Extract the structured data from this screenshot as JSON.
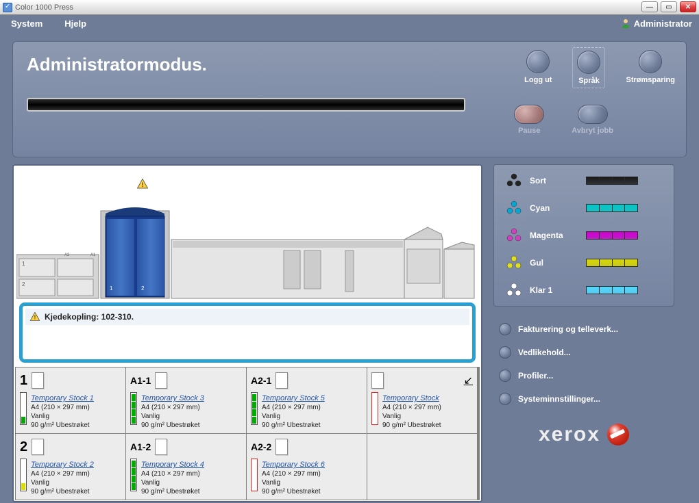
{
  "window": {
    "title": "Color 1000 Press"
  },
  "menu": {
    "system": "System",
    "help": "Hjelp",
    "admin": "Administrator"
  },
  "top": {
    "mode": "Administratormodus.",
    "logout": "Logg ut",
    "language": "Språk",
    "powersave": "Strømsparing",
    "pause": "Pause",
    "cancel": "Avbryt jobb"
  },
  "status": {
    "message": "Kjedekopling: 102-310."
  },
  "trays": {
    "size": "A4 (210 × 297 mm)",
    "type": "Vanlig",
    "coating": "90 g/m²   Ubestrøket",
    "items": [
      {
        "id": "1",
        "id_small": false,
        "stock": "Temporary Stock 1",
        "level_segs": [
          "green"
        ],
        "border": false
      },
      {
        "id": "A1-1",
        "id_small": true,
        "stock": "Temporary Stock 3",
        "level_segs": [
          "green",
          "green",
          "green",
          "green"
        ],
        "border": false
      },
      {
        "id": "A2-1",
        "id_small": true,
        "stock": "Temporary Stock 5",
        "level_segs": [
          "green",
          "green",
          "green",
          "green"
        ],
        "border": false
      },
      {
        "id": "",
        "id_small": true,
        "output": true,
        "stock": "Temporary Stock",
        "level_segs": [],
        "border": true
      },
      {
        "id": "2",
        "id_small": false,
        "stock": "Temporary Stock 2",
        "level_segs": [
          "yellow"
        ],
        "border": false
      },
      {
        "id": "A1-2",
        "id_small": true,
        "stock": "Temporary Stock 4",
        "level_segs": [
          "green",
          "green",
          "green",
          "green"
        ],
        "border": false
      },
      {
        "id": "A2-2",
        "id_small": true,
        "stock": "Temporary Stock 6",
        "level_segs": [],
        "border": true
      }
    ]
  },
  "toners": [
    {
      "name": "Sort",
      "color": "#1a1a1a",
      "pyr": "#222"
    },
    {
      "name": "Cyan",
      "color": "#00c8c8",
      "pyr": "#00a8d8"
    },
    {
      "name": "Magenta",
      "color": "#d000d0",
      "pyr": "#d040c0"
    },
    {
      "name": "Gul",
      "color": "#d8d800",
      "pyr": "#e0e020"
    },
    {
      "name": "Klar 1",
      "color": "#50d8ff",
      "pyr": "#ffffff"
    }
  ],
  "nav": [
    "Fakturering og telleverk...",
    "Vedlikehold...",
    "Profiler...",
    "Systeminnstillinger..."
  ],
  "brand": "xerox"
}
